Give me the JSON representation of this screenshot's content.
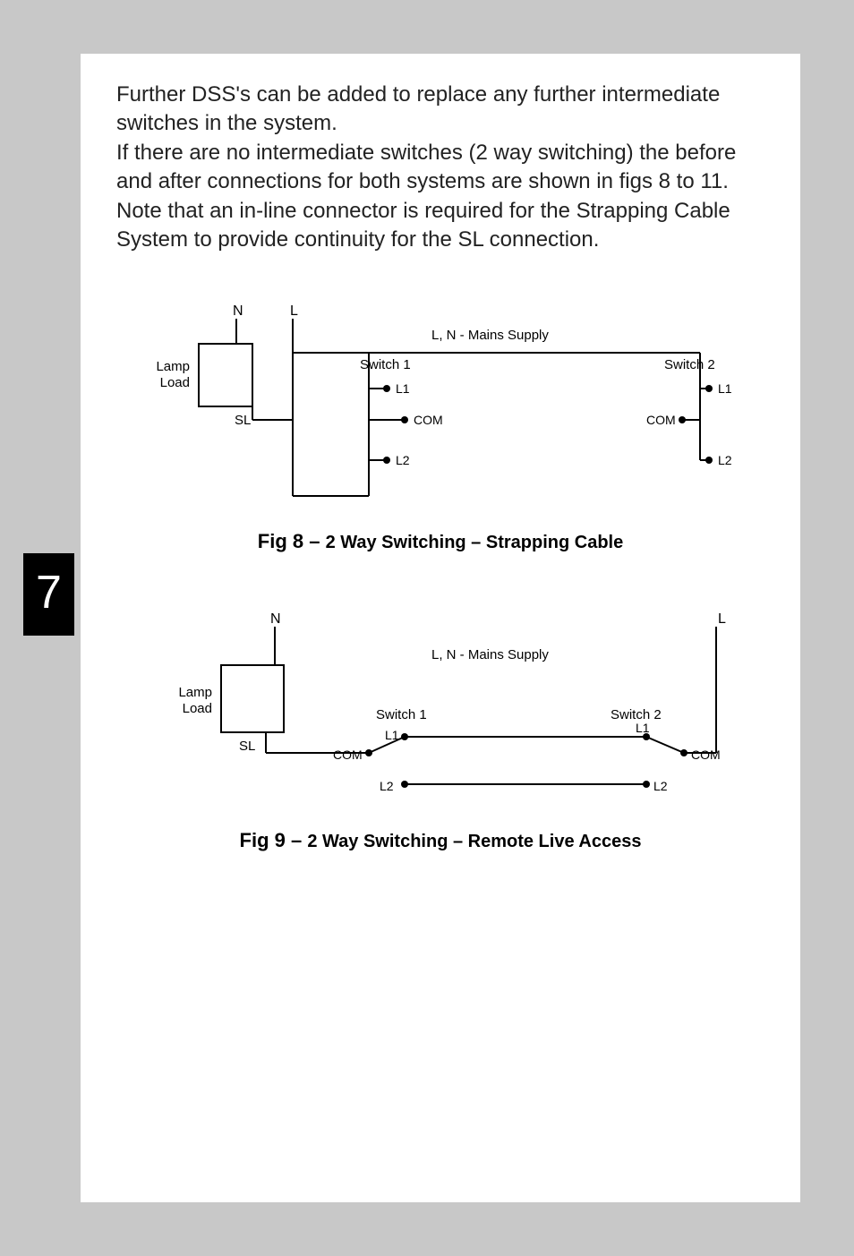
{
  "page_number": "7",
  "body": {
    "p1": "Further DSS's can be added to replace any further intermediate switches in the system.",
    "p2": "If there are no intermediate switches (2 way switching) the before and after connections for both systems are shown in figs 8 to 11. Note that an in-line connector is required for the Strapping Cable System to provide continuity for the SL connection."
  },
  "fig8": {
    "label": "Fig 8 – ",
    "desc": "2 Way Switching – Strapping Cable",
    "labels": {
      "N": "N",
      "L": "L",
      "mains": "L, N - Mains Supply",
      "lamp": "Lamp",
      "load": "Load",
      "sl": "SL",
      "sw1": "Switch 1",
      "sw2": "Switch 2",
      "l1": "L1",
      "com": "COM",
      "l2": "L2"
    }
  },
  "fig9": {
    "label": "Fig 9 – ",
    "desc": "2 Way Switching – Remote Live Access",
    "labels": {
      "N": "N",
      "L": "L",
      "mains": "L, N - Mains Supply",
      "lamp": "Lamp",
      "load": "Load",
      "sl": "SL",
      "sw1": "Switch 1",
      "sw2": "Switch 2",
      "l1": "L1",
      "com": "COM",
      "l2": "L2"
    }
  }
}
